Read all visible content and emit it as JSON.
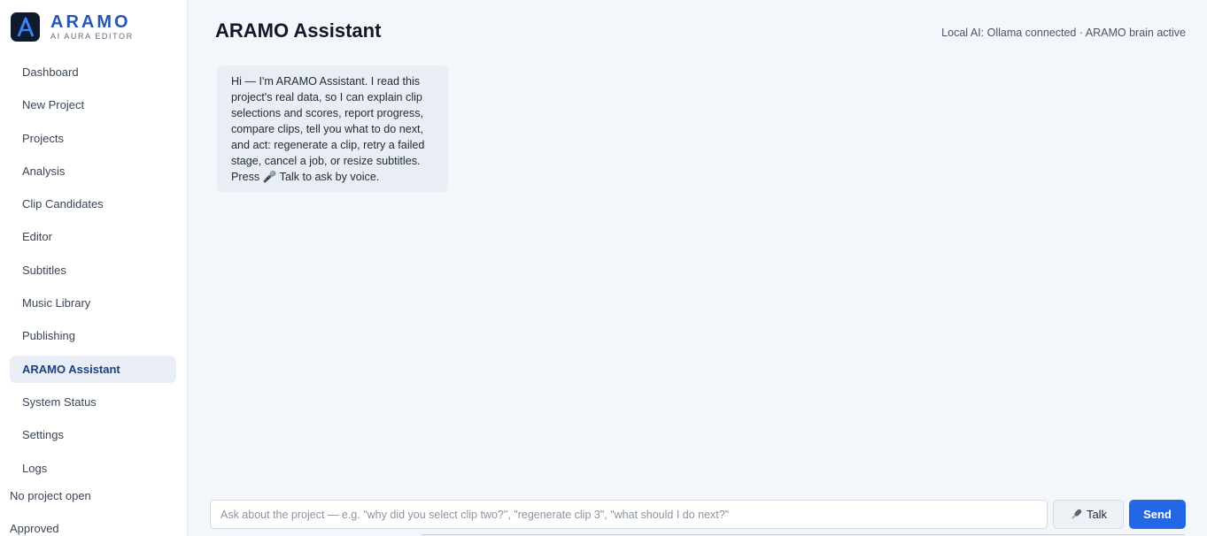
{
  "brand": {
    "name": "ARAMO",
    "subtitle": "AI AURA EDITOR",
    "logo_letter": "A",
    "logo_bg": "#0f1b2d",
    "accent": "#2456b8"
  },
  "sidebar": {
    "items": [
      {
        "label": "Dashboard"
      },
      {
        "label": "New Project"
      },
      {
        "label": "Projects"
      },
      {
        "label": "Analysis"
      },
      {
        "label": "Clip Candidates"
      },
      {
        "label": "Editor"
      },
      {
        "label": "Subtitles"
      },
      {
        "label": "Music Library"
      },
      {
        "label": "Publishing"
      },
      {
        "label": "ARAMO Assistant",
        "active": true
      },
      {
        "label": "System Status"
      },
      {
        "label": "Settings"
      },
      {
        "label": "Logs"
      }
    ],
    "project_status": "No project open",
    "approval_status": "Approved"
  },
  "header": {
    "title": "ARAMO Assistant",
    "status": "Local AI: Ollama connected · ARAMO brain active"
  },
  "chat": {
    "messages": [
      {
        "role": "assistant",
        "text": "Hi — I'm ARAMO Assistant. I read this project's real data, so I can explain clip selections and scores, report progress, compare clips, tell you what to do next, and act: regenerate a clip, retry a failed stage, cancel a job, or resize subtitles. Press 🎤 Talk to ask by voice."
      }
    ]
  },
  "composer": {
    "placeholder": "Ask about the project — e.g. \"why did you select clip two?\", \"regenerate clip 3\", \"what should I do next?\"",
    "value": "",
    "talk_label": "Talk",
    "talk_icon": "microphone-icon",
    "send_label": "Send",
    "send_color": "#2467e4"
  }
}
